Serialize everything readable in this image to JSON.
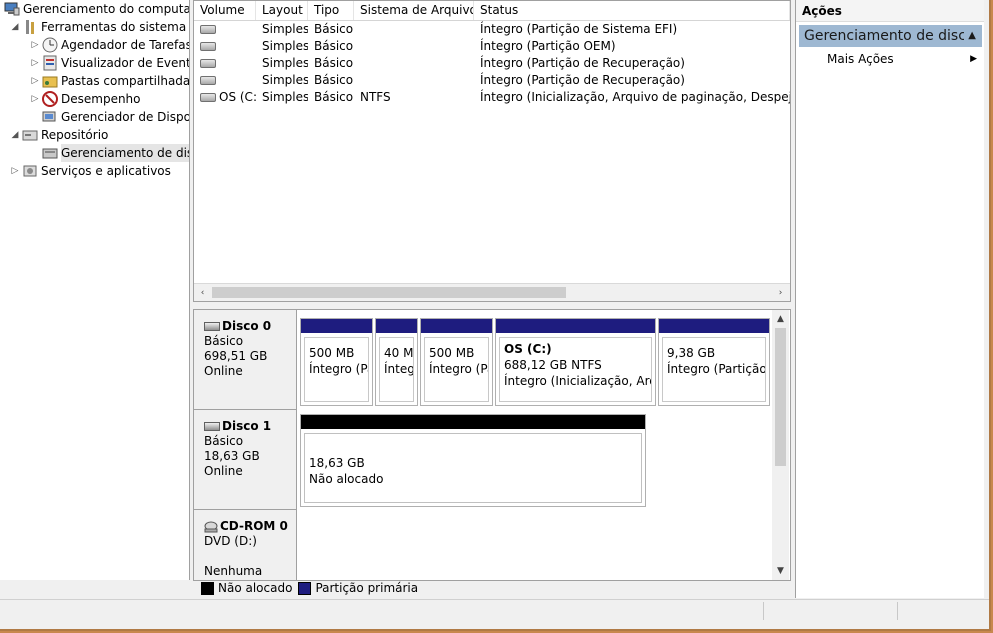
{
  "tree": {
    "root": "Gerenciamento do computador (Local)",
    "system_tools": "Ferramentas do sistema",
    "task_scheduler": "Agendador de Tarefas",
    "event_viewer": "Visualizador de Eventos",
    "shared_folders": "Pastas compartilhadas",
    "performance": "Desempenho",
    "device_manager": "Gerenciador de Dispositivos",
    "storage": "Repositório",
    "disk_management": "Gerenciamento de disco",
    "services_apps": "Serviços e aplicativos"
  },
  "volume_list": {
    "columns": [
      "Volume",
      "Layout",
      "Tipo",
      "Sistema de Arquivos",
      "Status"
    ],
    "rows": [
      {
        "volume": "",
        "layout": "Simples",
        "type": "Básico",
        "fs": "",
        "status": "Íntegro (Partição de Sistema EFI)"
      },
      {
        "volume": "",
        "layout": "Simples",
        "type": "Básico",
        "fs": "",
        "status": "Íntegro (Partição OEM)"
      },
      {
        "volume": "",
        "layout": "Simples",
        "type": "Básico",
        "fs": "",
        "status": "Íntegro (Partição de Recuperação)"
      },
      {
        "volume": "",
        "layout": "Simples",
        "type": "Básico",
        "fs": "",
        "status": "Íntegro (Partição de Recuperação)"
      },
      {
        "volume": "OS (C:)",
        "layout": "Simples",
        "type": "Básico",
        "fs": "NTFS",
        "status": "Íntegro (Inicialização, Arquivo de paginação, Despejo de memória"
      }
    ]
  },
  "disk0": {
    "name": "Disco 0",
    "type": "Básico",
    "size": "698,51 GB",
    "state": "Online",
    "partitions": [
      {
        "title": "",
        "size": "500 MB",
        "status": "Íntegro (Pa"
      },
      {
        "title": "",
        "size": "40 MB",
        "status": "Íntegro"
      },
      {
        "title": "",
        "size": "500 MB",
        "status": "Íntegro (Pa"
      },
      {
        "title": "OS  (C:)",
        "size": "688,12 GB NTFS",
        "status": "Íntegro (Inicialização, Arquiv"
      },
      {
        "title": "",
        "size": "9,38 GB",
        "status": "Íntegro (Partição d"
      }
    ]
  },
  "disk1": {
    "name": "Disco 1",
    "type": "Básico",
    "size": "18,63 GB",
    "state": "Online",
    "partition": {
      "size": "18,63 GB",
      "status": "Não alocado"
    }
  },
  "cdrom0": {
    "name": "CD-ROM 0",
    "drive": "DVD (D:)",
    "media": "Nenhuma mídia"
  },
  "legend": {
    "unallocated": "Não alocado",
    "primary": "Partição primária"
  },
  "colors": {
    "primary_partition": "#1e1c7f",
    "unallocated": "#000000",
    "action_header": "#9eb8d2"
  },
  "actions": {
    "title": "Ações",
    "group": "Gerenciamento de disco",
    "more": "Mais Ações"
  }
}
